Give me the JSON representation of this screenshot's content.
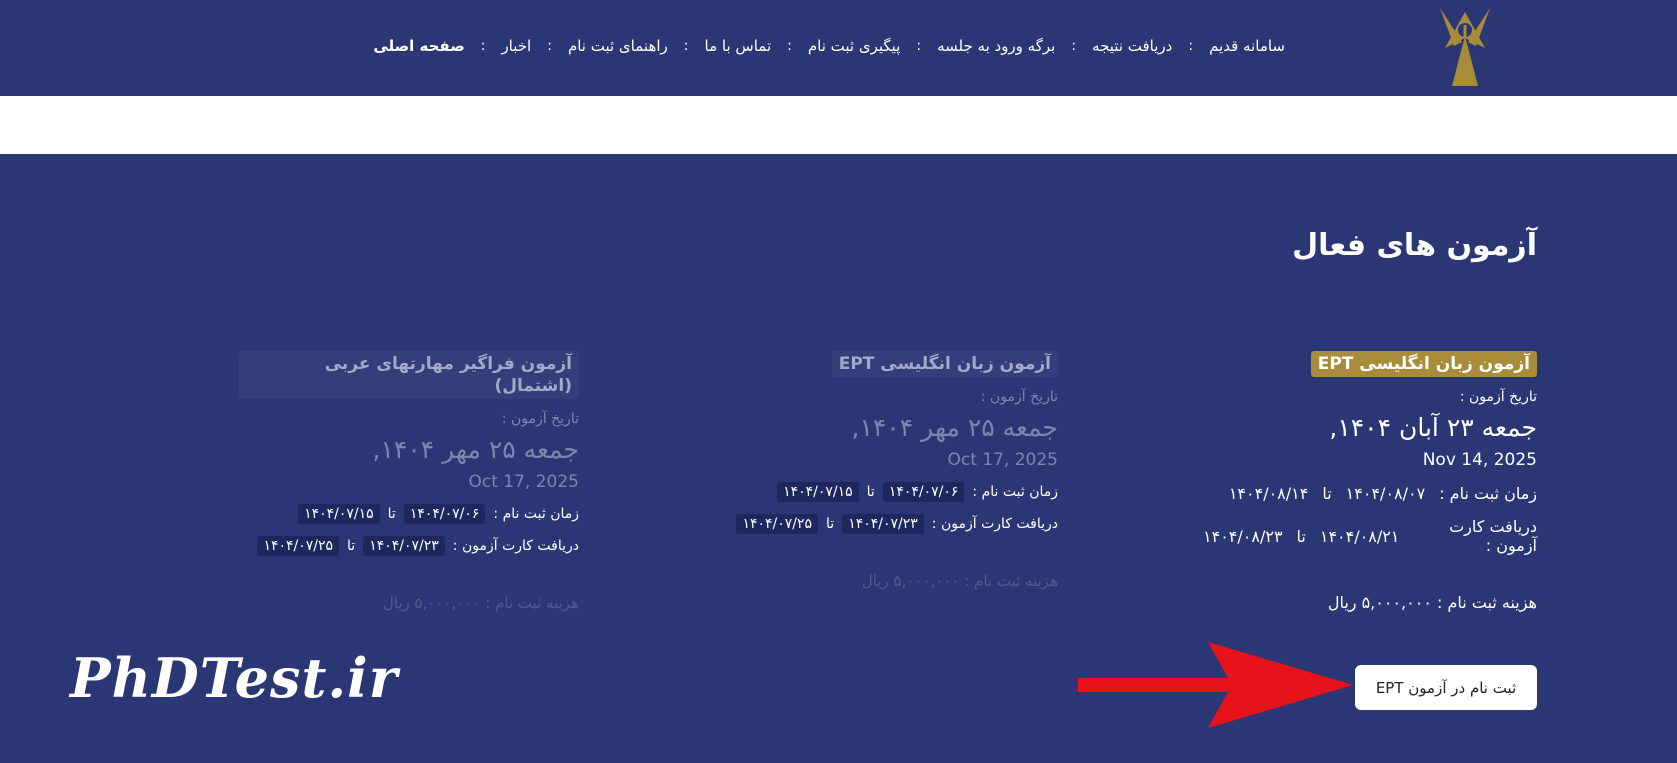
{
  "nav": {
    "items": [
      {
        "label": "صفحه اصلی"
      },
      {
        "label": "اخبار"
      },
      {
        "label": "راهنمای ثبت نام"
      },
      {
        "label": "تماس با ما"
      },
      {
        "label": "پیگیری ثبت نام"
      },
      {
        "label": "برگه ورود به جلسه"
      },
      {
        "label": "دریافت نتیجه"
      },
      {
        "label": "سامانه قدیم"
      }
    ],
    "separator": ":"
  },
  "section": {
    "title": "آزمون های فعال"
  },
  "cards": [
    {
      "title": "آزمون زبان انگلیسی EPT",
      "date_label": "تاریخ آزمون :",
      "date_fa": "جمعه ۲۳ آبان ۱۴۰۴,",
      "date_en": "Nov 14, 2025",
      "reg_label": "زمان ثبت نام :",
      "reg_from": "۱۴۰۴/۰۸/۰۷",
      "to": "تا",
      "reg_to": "۱۴۰۴/۰۸/۱۴",
      "card_label": "دریافت کارت آزمون :",
      "card_from": "۱۴۰۴/۰۸/۲۱",
      "card_to": "۱۴۰۴/۰۸/۲۳",
      "fee": "هزینه ثبت نام : ۵,۰۰۰,۰۰۰ ریال"
    },
    {
      "title": "آزمون زبان انگلیسی EPT",
      "date_label": "تاریخ آزمون :",
      "date_fa": "جمعه ۲۵ مهر ۱۴۰۴,",
      "date_en": "Oct 17, 2025",
      "reg_label": "زمان ثبت نام :",
      "reg_from": "۱۴۰۴/۰۷/۰۶",
      "to": "تا",
      "reg_to": "۱۴۰۴/۰۷/۱۵",
      "card_label": "دریافت کارت آزمون :",
      "card_from": "۱۴۰۴/۰۷/۲۳",
      "card_to": "۱۴۰۴/۰۷/۲۵",
      "fee": "هزینه ثبت نام : ۵,۰۰۰,۰۰۰ ریال"
    },
    {
      "title": "آزمون فراگیر مهارتهای عربی (اشتمال)",
      "date_label": "تاریخ آزمون :",
      "date_fa": "جمعه ۲۵ مهر ۱۴۰۴,",
      "date_en": "Oct 17, 2025",
      "reg_label": "زمان ثبت نام :",
      "reg_from": "۱۴۰۴/۰۷/۰۶",
      "to": "تا",
      "reg_to": "۱۴۰۴/۰۷/۱۵",
      "card_label": "دریافت کارت آزمون :",
      "card_from": "۱۴۰۴/۰۷/۲۳",
      "card_to": "۱۴۰۴/۰۷/۲۵",
      "fee": "هزینه ثبت نام : ۵,۰۰۰,۰۰۰ ریال"
    }
  ],
  "register_button": "ثبت نام در آزمون EPT",
  "watermark": "PhDTest.ir",
  "colors": {
    "background": "#2b3674",
    "highlight": "#a88c3a",
    "arrow": "#e8121b"
  },
  "icons": {
    "logo": "azad-university-logo",
    "arrow": "red-arrow-pointer"
  }
}
